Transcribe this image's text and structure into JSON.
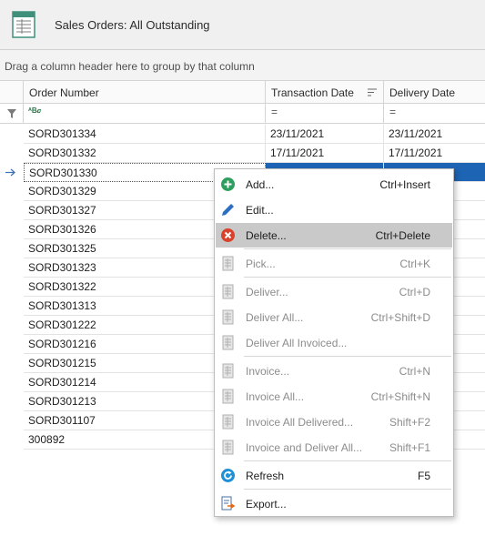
{
  "window": {
    "title": "Sales Orders: All Outstanding"
  },
  "groupby_hint": "Drag a column header here to group by that column",
  "columns": [
    "Order Number",
    "Transaction Date",
    "Delivery Date"
  ],
  "filter_row": {
    "order_number_operator": "ᴬB𝒄",
    "transaction_date_operator": "=",
    "delivery_date_operator": "="
  },
  "rows": [
    {
      "order": "SORD301334",
      "tdate": "23/11/2021",
      "ddate": "23/11/2021"
    },
    {
      "order": "SORD301332",
      "tdate": "17/11/2021",
      "ddate": "17/11/2021"
    },
    {
      "order": "SORD301330",
      "tdate": "",
      "ddate": ""
    },
    {
      "order": "SORD301329",
      "tdate": "",
      "ddate": ""
    },
    {
      "order": "SORD301327",
      "tdate": "",
      "ddate": ""
    },
    {
      "order": "SORD301326",
      "tdate": "",
      "ddate": ""
    },
    {
      "order": "SORD301325",
      "tdate": "",
      "ddate": ""
    },
    {
      "order": "SORD301323",
      "tdate": "",
      "ddate": ""
    },
    {
      "order": "SORD301322",
      "tdate": "",
      "ddate": ""
    },
    {
      "order": "SORD301313",
      "tdate": "",
      "ddate": ""
    },
    {
      "order": "SORD301222",
      "tdate": "",
      "ddate": ""
    },
    {
      "order": "SORD301216",
      "tdate": "",
      "ddate": ""
    },
    {
      "order": "SORD301215",
      "tdate": "",
      "ddate": ""
    },
    {
      "order": "SORD301214",
      "tdate": "",
      "ddate": ""
    },
    {
      "order": "SORD301213",
      "tdate": "",
      "ddate": ""
    },
    {
      "order": "SORD301107",
      "tdate": "",
      "ddate": ""
    },
    {
      "order": "300892",
      "tdate": "",
      "ddate": ""
    }
  ],
  "selected_row": 2,
  "context_menu": [
    {
      "label": "Add...",
      "shortcut": "Ctrl+Insert",
      "icon": "add-icon",
      "enabled": true
    },
    {
      "label": "Edit...",
      "shortcut": "",
      "icon": "pencil-icon",
      "enabled": true
    },
    {
      "label": "Delete...",
      "shortcut": "Ctrl+Delete",
      "icon": "delete-icon",
      "enabled": true,
      "highlighted": true
    },
    {
      "label": "Pick...",
      "shortcut": "Ctrl+K",
      "icon": "document-icon",
      "enabled": false
    },
    {
      "label": "Deliver...",
      "shortcut": "Ctrl+D",
      "icon": "document-icon",
      "enabled": false
    },
    {
      "label": "Deliver All...",
      "shortcut": "Ctrl+Shift+D",
      "icon": "document-icon",
      "enabled": false
    },
    {
      "label": "Deliver All Invoiced...",
      "shortcut": "",
      "icon": "document-icon",
      "enabled": false
    },
    {
      "label": "Invoice...",
      "shortcut": "Ctrl+N",
      "icon": "document-icon",
      "enabled": false
    },
    {
      "label": "Invoice All...",
      "shortcut": "Ctrl+Shift+N",
      "icon": "document-icon",
      "enabled": false
    },
    {
      "label": "Invoice All Delivered...",
      "shortcut": "Shift+F2",
      "icon": "document-icon",
      "enabled": false
    },
    {
      "label": "Invoice and Deliver All...",
      "shortcut": "Shift+F1",
      "icon": "document-icon",
      "enabled": false
    },
    {
      "label": "Refresh",
      "shortcut": "F5",
      "icon": "refresh-icon",
      "enabled": true
    },
    {
      "label": "Export...",
      "shortcut": "",
      "icon": "export-icon",
      "enabled": true
    }
  ],
  "colors": {
    "selection": "#1e64b4",
    "menu_highlight": "#c9c9c9",
    "add_green": "#2e9e5e",
    "delete_red": "#d9412a",
    "refresh_blue": "#1f8fd6",
    "edit_blue": "#2b6fc2"
  }
}
